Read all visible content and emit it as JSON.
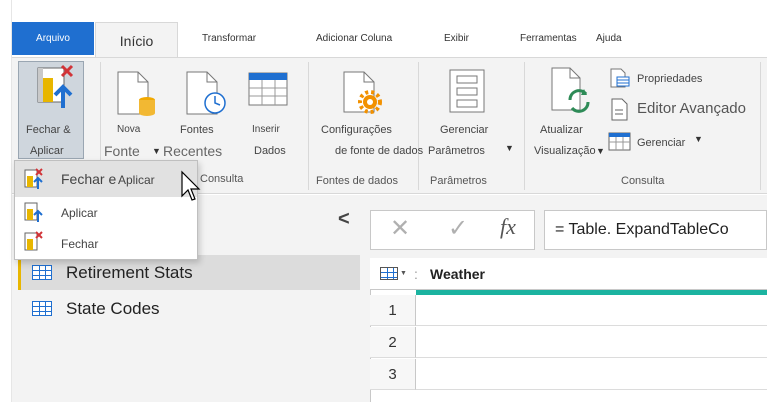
{
  "tabs": {
    "arquivo": "Arquivo",
    "inicio": "Início",
    "transformar": "Transformar",
    "adicionar_coluna": "Adicionar Coluna",
    "exibir": "Exibir",
    "ferramentas": "Ferramentas",
    "ajuda": "Ajuda"
  },
  "ribbon": {
    "fechar_aplicar_1": "Fechar &",
    "fechar_aplicar_2": "Aplicar",
    "nova_1": "Nova",
    "nova_2": "Fonte",
    "fontes_1": "Fontes",
    "fontes_2": "Recentes",
    "inserir_1": "Inserir",
    "inserir_2": "Dados",
    "config_1": "Configurações",
    "config_2": "de fonte de dados",
    "gerenciar_param_1": "Gerenciar",
    "gerenciar_param_2": "Parâmetros",
    "atualizar_1": "Atualizar",
    "atualizar_2": "Visualização",
    "propriedades": "Propriedades",
    "editor_avancado": "Editor Avançado",
    "gerenciar": "Gerenciar",
    "group_consulta_left": "Consulta",
    "group_fontes": "Fontes de dados",
    "group_parametros": "Parâmetros",
    "group_consulta": "Consulta"
  },
  "popup": {
    "item1_a": "Fechar e",
    "item1_b": "Aplicar",
    "item2": "Aplicar",
    "item3": "Fechar"
  },
  "queries": {
    "collapse_glyph": "<",
    "items": [
      "Retirement Stats",
      "State Codes"
    ]
  },
  "formula": {
    "cancel_glyph": "✕",
    "confirm_glyph": "✓",
    "fx": "fx",
    "text": "= Table. ExpandTableCo"
  },
  "table": {
    "column": "Weather",
    "rows": [
      "1",
      "2",
      "3"
    ]
  },
  "colors": {
    "accent": "#1f6fd0",
    "teal": "#1bb3a0",
    "selection_marker": "#e8b600"
  },
  "icons": [
    "close-apply-icon",
    "new-source-icon",
    "recent-sources-icon",
    "enter-data-icon",
    "data-source-settings-icon",
    "manage-parameters-icon",
    "refresh-preview-icon",
    "properties-icon",
    "advanced-editor-icon",
    "manage-icon",
    "table-icon",
    "mouse-cursor-icon"
  ]
}
